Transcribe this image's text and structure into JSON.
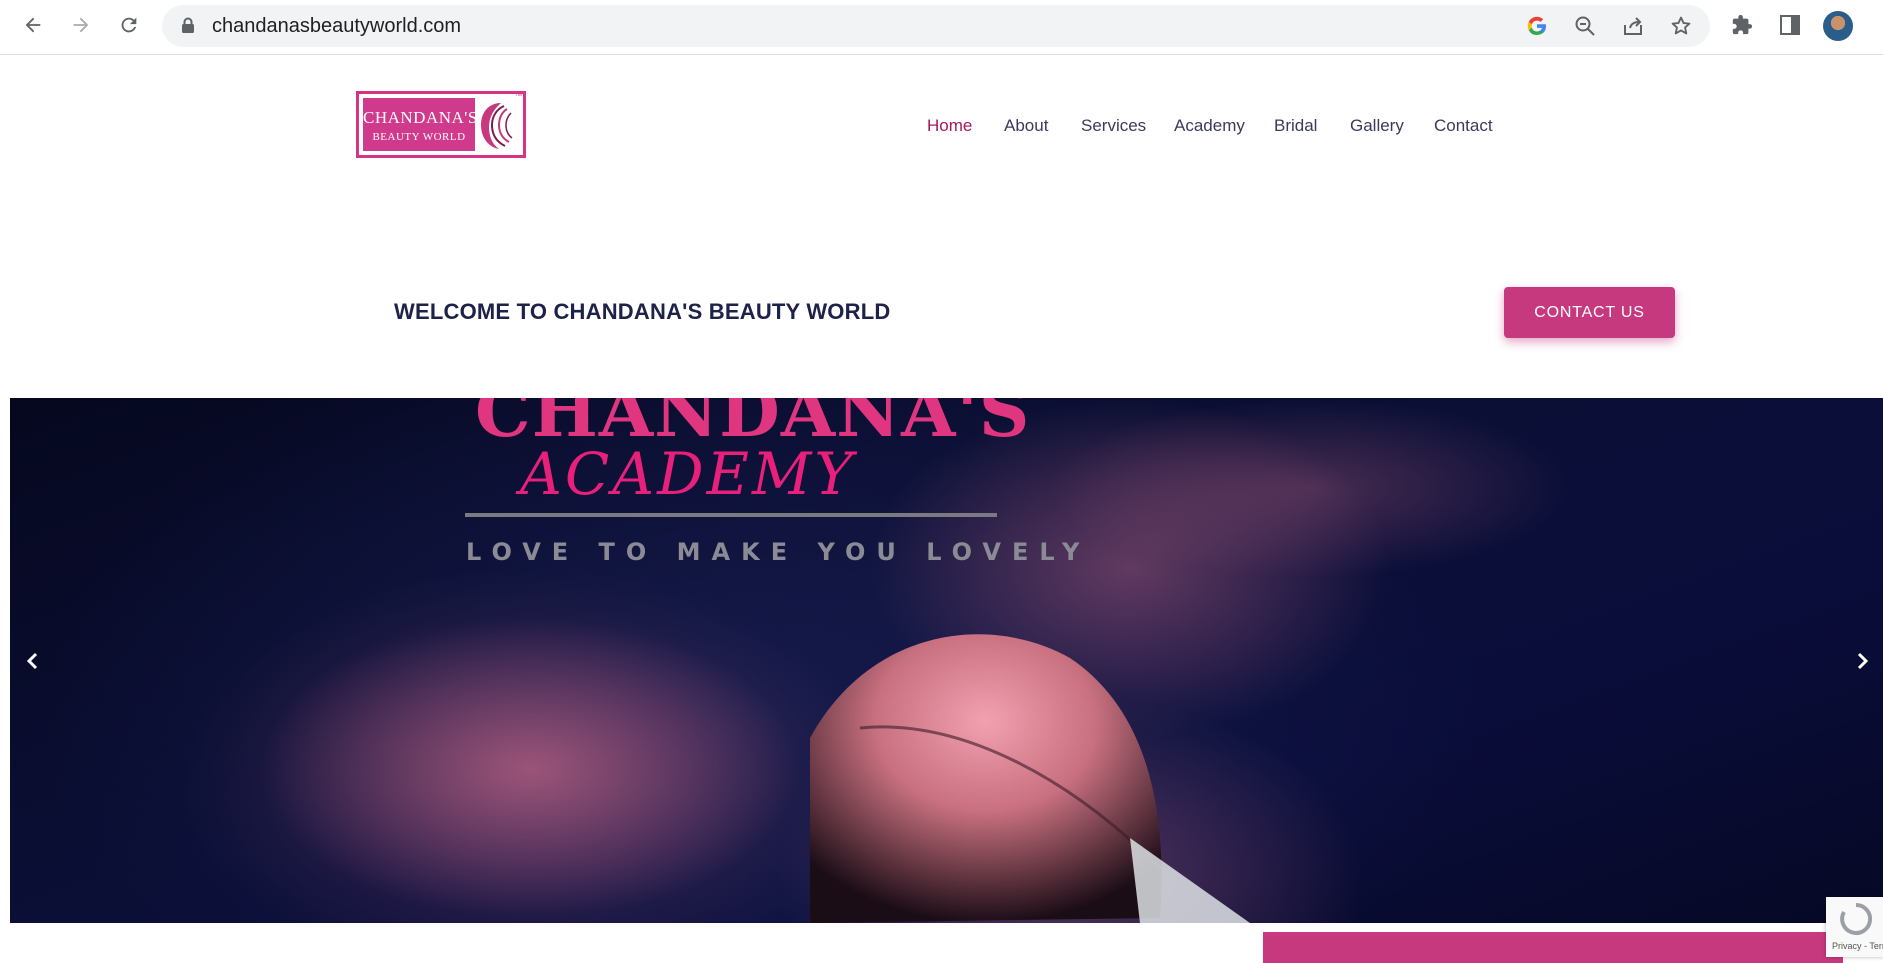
{
  "browser": {
    "url": "chandanasbeautyworld.com",
    "icons": [
      "back-arrow-icon",
      "forward-arrow-icon",
      "reload-icon",
      "lock-icon",
      "google-icon",
      "zoom-out-icon",
      "share-icon",
      "star-icon",
      "extensions-icon",
      "side-panel-icon",
      "profile-avatar"
    ]
  },
  "logo": {
    "line1": "CHANDANA'S",
    "line2": "BEAUTY WORLD",
    "tm": "™"
  },
  "nav": {
    "items": [
      {
        "label": "Home",
        "active": true
      },
      {
        "label": "About"
      },
      {
        "label": "Services"
      },
      {
        "label": "Academy"
      },
      {
        "label": "Bridal"
      },
      {
        "label": "Gallery"
      },
      {
        "label": "Contact"
      }
    ]
  },
  "banner": {
    "welcome": "WELCOME TO CHANDANA'S BEAUTY WORLD",
    "contact_button": "CONTACT US"
  },
  "hero": {
    "title": "CHANDANA'S",
    "subtitle": "ACADEMY",
    "tagline": "LOVE TO MAKE YOU LOVELY"
  },
  "recaptcha": {
    "text": "Privacy - Terms"
  },
  "colors": {
    "brand_pink": "#c7397f",
    "nav_active": "#a3185f",
    "heading_navy": "#1e2148"
  }
}
